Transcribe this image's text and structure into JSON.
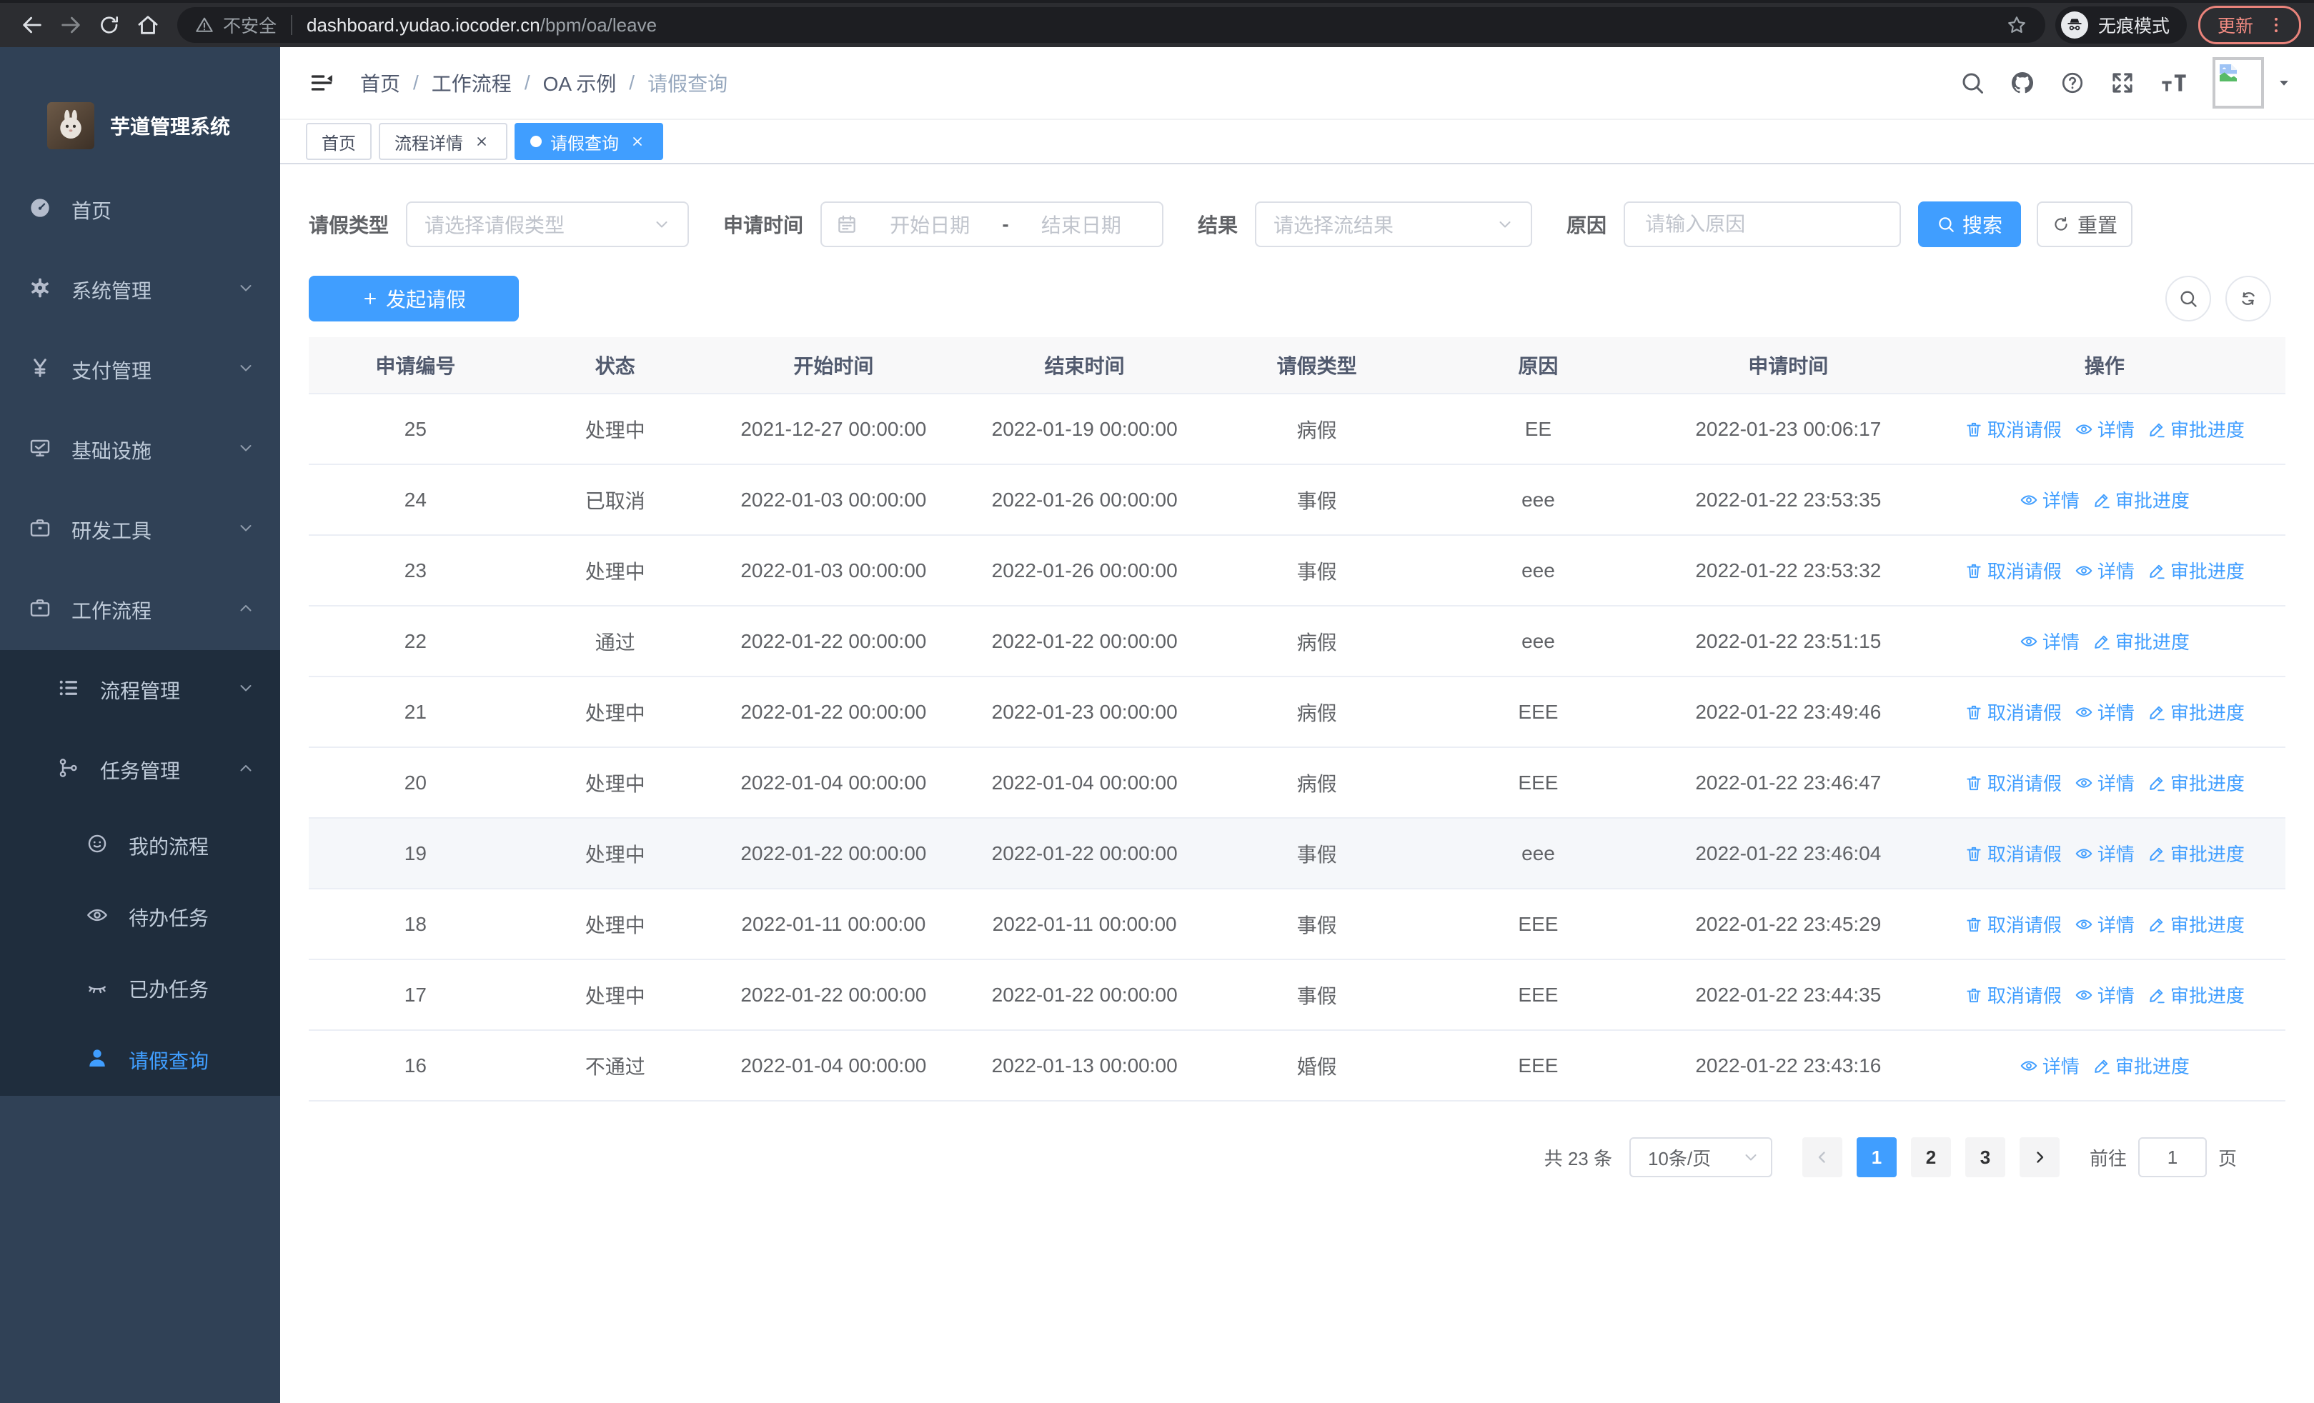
{
  "browser": {
    "security_label": "不安全",
    "url_host": "dashboard.yudao.iocoder.cn",
    "url_path": "/bpm/oa/leave",
    "incognito_label": "无痕模式",
    "update_label": "更新"
  },
  "sidebar": {
    "app_title": "芋道管理系统",
    "items": [
      {
        "key": "home",
        "label": "首页",
        "icon": "dashboard",
        "level": 1,
        "chevron": null,
        "dark": false,
        "active": false
      },
      {
        "key": "system-management",
        "label": "系统管理",
        "icon": "gear",
        "level": 1,
        "chevron": "down",
        "dark": false,
        "active": false
      },
      {
        "key": "payment-management",
        "label": "支付管理",
        "icon": "yen",
        "level": 1,
        "chevron": "down",
        "dark": false,
        "active": false
      },
      {
        "key": "infrastructure",
        "label": "基础设施",
        "icon": "monitor",
        "level": 1,
        "chevron": "down",
        "dark": false,
        "active": false
      },
      {
        "key": "dev-tools",
        "label": "研发工具",
        "icon": "toolbox",
        "level": 1,
        "chevron": "down",
        "dark": false,
        "active": false
      },
      {
        "key": "workflow",
        "label": "工作流程",
        "icon": "toolbox",
        "level": 1,
        "chevron": "up",
        "dark": false,
        "active": false
      },
      {
        "key": "process-management",
        "label": "流程管理",
        "icon": "tree",
        "level": 2,
        "chevron": "down",
        "dark": true,
        "active": false
      },
      {
        "key": "task-management",
        "label": "任务管理",
        "icon": "org",
        "level": 2,
        "chevron": "up",
        "dark": true,
        "active": false
      },
      {
        "key": "my-process",
        "label": "我的流程",
        "icon": "face",
        "level": 3,
        "chevron": null,
        "dark": true,
        "active": false
      },
      {
        "key": "todo-tasks",
        "label": "待办任务",
        "icon": "eye",
        "level": 3,
        "chevron": null,
        "dark": true,
        "active": false
      },
      {
        "key": "done-tasks",
        "label": "已办任务",
        "icon": "eye-closed",
        "level": 3,
        "chevron": null,
        "dark": true,
        "active": false
      },
      {
        "key": "leave-query",
        "label": "请假查询",
        "icon": "user",
        "level": 3,
        "chevron": null,
        "dark": true,
        "active": true
      }
    ]
  },
  "breadcrumb": {
    "items": [
      "首页",
      "工作流程",
      "OA 示例",
      "请假查询"
    ]
  },
  "tabs": [
    {
      "label": "首页",
      "closable": false,
      "active": false
    },
    {
      "label": "流程详情",
      "closable": true,
      "active": false
    },
    {
      "label": "请假查询",
      "closable": true,
      "active": true
    }
  ],
  "header_icons": [
    "search",
    "github",
    "question",
    "fullscreen",
    "font-size"
  ],
  "filters": {
    "leave_type_label": "请假类型",
    "leave_type_placeholder": "请选择请假类型",
    "apply_time_label": "申请时间",
    "start_date_placeholder": "开始日期",
    "range_separator": "-",
    "end_date_placeholder": "结束日期",
    "result_label": "结果",
    "result_placeholder": "请选择流结果",
    "reason_label": "原因",
    "reason_placeholder": "请输入原因",
    "search_button": "搜索",
    "reset_button": "重置"
  },
  "toolbar": {
    "create_button": "发起请假"
  },
  "table": {
    "columns": [
      {
        "key": "id",
        "label": "申请编号"
      },
      {
        "key": "status",
        "label": "状态"
      },
      {
        "key": "start_time",
        "label": "开始时间"
      },
      {
        "key": "end_time",
        "label": "结束时间"
      },
      {
        "key": "leave_type",
        "label": "请假类型"
      },
      {
        "key": "reason",
        "label": "原因"
      },
      {
        "key": "apply_time",
        "label": "申请时间"
      },
      {
        "key": "ops",
        "label": "操作"
      }
    ],
    "action_labels": {
      "cancel": {
        "label": "取消请假",
        "icon": "trash"
      },
      "detail": {
        "label": "详情",
        "icon": "eye"
      },
      "progress": {
        "label": "审批进度",
        "icon": "edit"
      }
    },
    "rows": [
      {
        "id": "25",
        "status": "处理中",
        "start_time": "2021-12-27 00:00:00",
        "end_time": "2022-01-19 00:00:00",
        "leave_type": "病假",
        "reason": "EE",
        "apply_time": "2022-01-23 00:06:17",
        "actions": [
          "cancel",
          "detail",
          "progress"
        ],
        "highlight": false
      },
      {
        "id": "24",
        "status": "已取消",
        "start_time": "2022-01-03 00:00:00",
        "end_time": "2022-01-26 00:00:00",
        "leave_type": "事假",
        "reason": "eee",
        "apply_time": "2022-01-22 23:53:35",
        "actions": [
          "detail",
          "progress"
        ],
        "highlight": false
      },
      {
        "id": "23",
        "status": "处理中",
        "start_time": "2022-01-03 00:00:00",
        "end_time": "2022-01-26 00:00:00",
        "leave_type": "事假",
        "reason": "eee",
        "apply_time": "2022-01-22 23:53:32",
        "actions": [
          "cancel",
          "detail",
          "progress"
        ],
        "highlight": false
      },
      {
        "id": "22",
        "status": "通过",
        "start_time": "2022-01-22 00:00:00",
        "end_time": "2022-01-22 00:00:00",
        "leave_type": "病假",
        "reason": "eee",
        "apply_time": "2022-01-22 23:51:15",
        "actions": [
          "detail",
          "progress"
        ],
        "highlight": false
      },
      {
        "id": "21",
        "status": "处理中",
        "start_time": "2022-01-22 00:00:00",
        "end_time": "2022-01-23 00:00:00",
        "leave_type": "病假",
        "reason": "EEE",
        "apply_time": "2022-01-22 23:49:46",
        "actions": [
          "cancel",
          "detail",
          "progress"
        ],
        "highlight": false
      },
      {
        "id": "20",
        "status": "处理中",
        "start_time": "2022-01-04 00:00:00",
        "end_time": "2022-01-04 00:00:00",
        "leave_type": "病假",
        "reason": "EEE",
        "apply_time": "2022-01-22 23:46:47",
        "actions": [
          "cancel",
          "detail",
          "progress"
        ],
        "highlight": false
      },
      {
        "id": "19",
        "status": "处理中",
        "start_time": "2022-01-22 00:00:00",
        "end_time": "2022-01-22 00:00:00",
        "leave_type": "事假",
        "reason": "eee",
        "apply_time": "2022-01-22 23:46:04",
        "actions": [
          "cancel",
          "detail",
          "progress"
        ],
        "highlight": true
      },
      {
        "id": "18",
        "status": "处理中",
        "start_time": "2022-01-11 00:00:00",
        "end_time": "2022-01-11 00:00:00",
        "leave_type": "事假",
        "reason": "EEE",
        "apply_time": "2022-01-22 23:45:29",
        "actions": [
          "cancel",
          "detail",
          "progress"
        ],
        "highlight": false
      },
      {
        "id": "17",
        "status": "处理中",
        "start_time": "2022-01-22 00:00:00",
        "end_time": "2022-01-22 00:00:00",
        "leave_type": "事假",
        "reason": "EEE",
        "apply_time": "2022-01-22 23:44:35",
        "actions": [
          "cancel",
          "detail",
          "progress"
        ],
        "highlight": false
      },
      {
        "id": "16",
        "status": "不通过",
        "start_time": "2022-01-04 00:00:00",
        "end_time": "2022-01-13 00:00:00",
        "leave_type": "婚假",
        "reason": "EEE",
        "apply_time": "2022-01-22 23:43:16",
        "actions": [
          "detail",
          "progress"
        ],
        "highlight": false
      }
    ]
  },
  "pagination": {
    "total_label": "共 23 条",
    "page_size_label": "10条/页",
    "pages": [
      "1",
      "2",
      "3"
    ],
    "active_page": "1",
    "goto_label": "前往",
    "goto_value": "1",
    "goto_unit_label": "页"
  },
  "colors": {
    "primary": "#409eff",
    "sidebar_bg": "#304156",
    "sidebar_submenu_bg": "#1f2d3d",
    "sidebar_text": "#bfcbd9",
    "tab_active_bg": "#409eff",
    "update_badge": "#f28b82",
    "table_header_bg": "#f8f8f9",
    "row_highlight": "#f5f7fa"
  }
}
